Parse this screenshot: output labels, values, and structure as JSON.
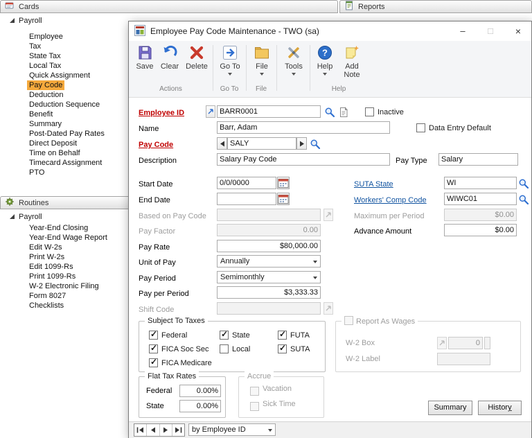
{
  "colors": {
    "selection_highlight": "#f5a93c",
    "required_label": "#c00000",
    "link_label": "#1053a0",
    "ribbon_bg": "#f4f5f7"
  },
  "icons": {
    "cards": "index-card",
    "routines": "gear",
    "reports": "report-page",
    "window": "app-window",
    "save": "floppy-disk",
    "clear": "undo-arrow",
    "delete": "red-x",
    "goto": "arrow-box",
    "file": "folder",
    "tools": "crossed-tools",
    "help": "question-circle",
    "add_note": "note-sparkle",
    "lookup": "magnifier",
    "calendar": "calendar-grid",
    "expansion": "expand-arrow",
    "note": "paper-sheet",
    "browse": "vcr-arrows"
  },
  "nav": {
    "cards": {
      "title": "Cards",
      "root": "Payroll",
      "selected_item": "Pay Code",
      "items": [
        "Employee",
        "Tax",
        "State Tax",
        "Local Tax",
        "Quick Assignment",
        "Pay Code",
        "Deduction",
        "Deduction Sequence",
        "Benefit",
        "Summary",
        "Post-Dated Pay Rates",
        "Direct Deposit",
        "Time on Behalf",
        "Timecard Assignment",
        "PTO"
      ]
    },
    "routines": {
      "title": "Routines",
      "root": "Payroll",
      "items": [
        "Year-End Closing",
        "Year-End Wage Report",
        "Edit W-2s",
        "Print W-2s",
        "Edit 1099-Rs",
        "Print 1099-Rs",
        "W-2 Electronic Filing",
        "Form 8027",
        "Checklists"
      ]
    },
    "reports": {
      "title": "Reports"
    }
  },
  "window": {
    "title": "Employee Pay Code Maintenance - TWO (sa)",
    "minimize": "–",
    "maximize": "□",
    "close": "×"
  },
  "ribbon": {
    "save": "Save",
    "clear": "Clear",
    "delete": "Delete",
    "goto": "Go To",
    "file": "File",
    "tools": "Tools",
    "help": "Help",
    "add_note_line1": "Add",
    "add_note_line2": "Note",
    "groups": {
      "actions": "Actions",
      "goto": "Go To",
      "file": "File",
      "help": "Help"
    }
  },
  "form": {
    "employee_id": {
      "label": "Employee ID",
      "value": "BARR0001"
    },
    "inactive": {
      "label": "Inactive",
      "checked": false
    },
    "name": {
      "label": "Name",
      "value": "Barr, Adam"
    },
    "data_entry_default": {
      "label": "Data Entry Default",
      "checked": false
    },
    "pay_code": {
      "label": "Pay Code",
      "value": "SALY"
    },
    "description": {
      "label": "Description",
      "value": "Salary Pay Code"
    },
    "pay_type": {
      "label": "Pay Type",
      "value": "Salary"
    },
    "start_date": {
      "label": "Start Date",
      "value": "0/0/0000"
    },
    "end_date": {
      "label": "End Date",
      "value": ""
    },
    "based_on_pay_code": {
      "label": "Based on Pay Code",
      "value": ""
    },
    "pay_factor": {
      "label": "Pay Factor",
      "value": "0.00"
    },
    "pay_rate": {
      "label": "Pay Rate",
      "value": "$80,000.00"
    },
    "unit_of_pay": {
      "label": "Unit of Pay",
      "value": "Annually"
    },
    "pay_period": {
      "label": "Pay Period",
      "value": "Semimonthly"
    },
    "pay_per_period": {
      "label": "Pay per Period",
      "value": "$3,333.33"
    },
    "shift_code": {
      "label": "Shift Code",
      "value": ""
    },
    "suta_state": {
      "label": "SUTA State",
      "value": "WI"
    },
    "workers_comp_code": {
      "label": "Workers' Comp Code",
      "value": "WIWC01"
    },
    "maximum_per_period": {
      "label": "Maximum per Period",
      "value": "$0.00"
    },
    "advance_amount": {
      "label": "Advance Amount",
      "value": "$0.00"
    }
  },
  "subject_to_taxes": {
    "title": "Subject To Taxes",
    "federal": {
      "label": "Federal",
      "checked": true
    },
    "fica_soc_sec": {
      "label": "FICA Soc Sec",
      "checked": true
    },
    "fica_medicare": {
      "label": "FICA Medicare",
      "checked": true
    },
    "state": {
      "label": "State",
      "checked": true
    },
    "local": {
      "label": "Local",
      "checked": false
    },
    "futa": {
      "label": "FUTA",
      "checked": true
    },
    "suta": {
      "label": "SUTA",
      "checked": true
    }
  },
  "report_as_wages": {
    "title": "Report As Wages",
    "checked": false,
    "w2_box": {
      "label": "W-2 Box",
      "value": "0"
    },
    "w2_label": {
      "label": "W-2 Label",
      "value": ""
    }
  },
  "flat_tax_rates": {
    "title": "Flat Tax Rates",
    "federal": {
      "label": "Federal",
      "value": "0.00%"
    },
    "state": {
      "label": "State",
      "value": "0.00%"
    }
  },
  "accrue": {
    "title": "Accrue",
    "vacation": {
      "label": "Vacation",
      "checked": false
    },
    "sick_time": {
      "label": "Sick Time",
      "checked": false
    }
  },
  "footer_buttons": {
    "summary": "Summary",
    "history_pre": "Histor",
    "history_accel": "y"
  },
  "record_browser": {
    "sort_by": "by Employee ID"
  }
}
